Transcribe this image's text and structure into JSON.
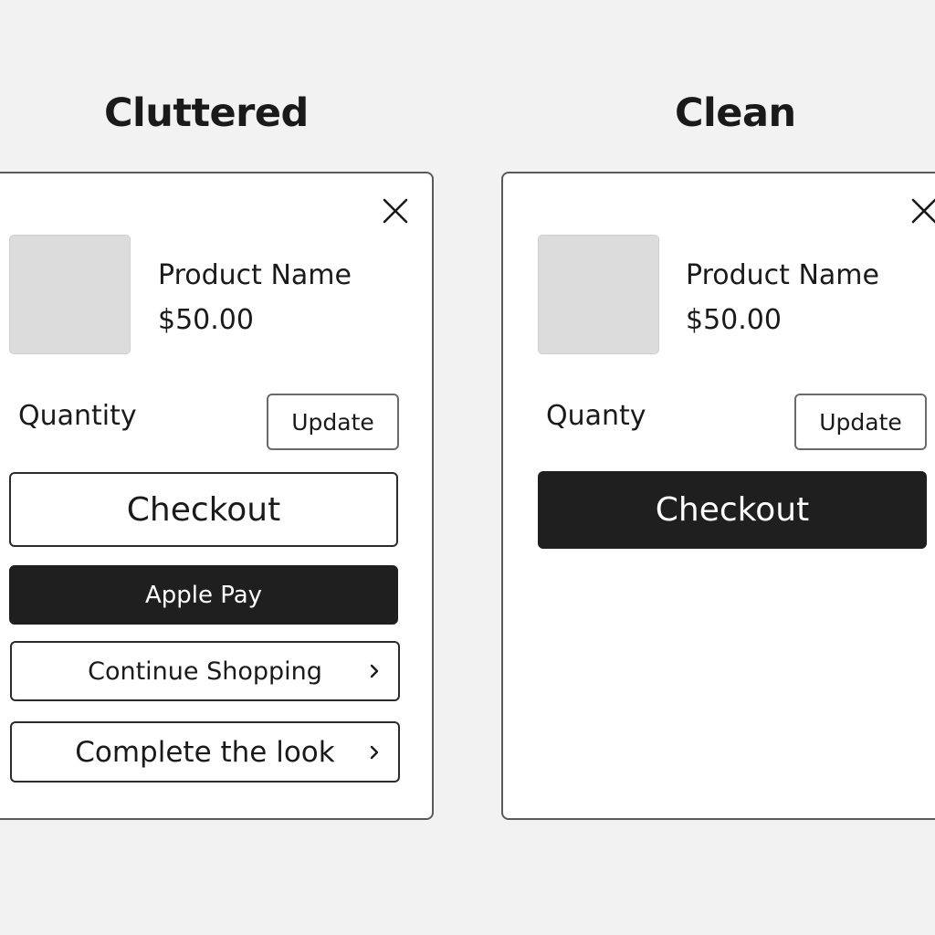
{
  "cluttered": {
    "heading": "Cluttered",
    "product_name": "Product Name",
    "price": "$50.00",
    "quantity_label": "Quantity",
    "update_label": "Update",
    "checkout_label": "Checkout",
    "apple_pay_label": "Apple Pay",
    "continue_shopping_label": "Continue Shopping",
    "complete_look_label": "Complete the look"
  },
  "clean": {
    "heading": "Clean",
    "product_name": "Product Name",
    "price": "$50.00",
    "quantity_label": "Quanty",
    "update_label": "Update",
    "checkout_label": "Checkout"
  },
  "icons": {
    "close": "close-icon",
    "chevron": "chevron-right-icon"
  },
  "colors": {
    "background": "#f2f2f2",
    "panel": "#ffffff",
    "border": "#2b2b2b",
    "dark_button": "#1f1f1f",
    "thumbnail": "#dcdcdc"
  }
}
